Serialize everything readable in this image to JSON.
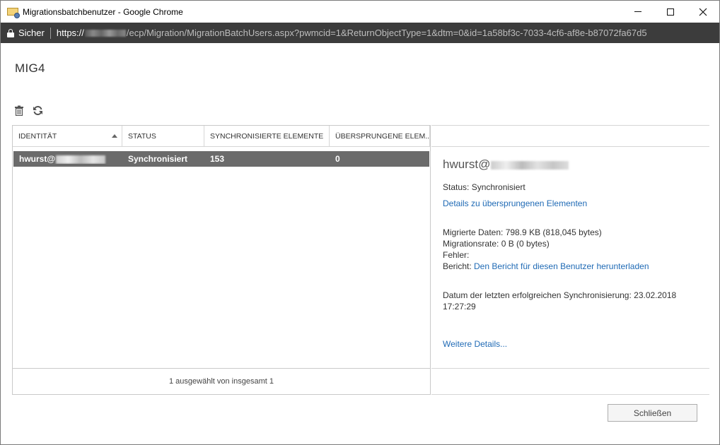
{
  "window": {
    "title": "Migrationsbatchbenutzer - Google Chrome",
    "buttons": {
      "minimize": "minimize",
      "maximize": "maximize",
      "close": "✕"
    }
  },
  "address": {
    "secure_label": "Sicher",
    "url_scheme": "https://",
    "url_rest": "/ecp/Migration/MigrationBatchUsers.aspx?pwmcid=1&ReturnObjectType=1&dtm=0&id=1a58bf3c-7033-4cf6-af8e-b87072fa67d5"
  },
  "page": {
    "title": "MIG4",
    "toolbar": {
      "delete_icon": "trash-icon",
      "refresh_icon": "refresh-icon"
    }
  },
  "table": {
    "columns": [
      "IDENTITÄT",
      "STATUS",
      "SYNCHRONISIERTE ELEMENTE",
      "ÜBERSPRUNGENE ELEM..."
    ],
    "rows": [
      {
        "identity_prefix": "hwurst@",
        "status": "Synchronisiert",
        "synced": "153",
        "skipped": "0"
      }
    ],
    "footer": "1 ausgewählt von insgesamt 1"
  },
  "details": {
    "name_prefix": "hwurst@",
    "status": "Status: Synchronisiert",
    "skipped_link": "Details zu übersprungenen Elementen",
    "migrated_data": "Migrierte Daten: 798.9 KB (818,045 bytes)",
    "migration_rate": "Migrationsrate: 0 B (0 bytes)",
    "errors": "Fehler:",
    "report_label": "Bericht: ",
    "report_link": "Den Bericht für diesen Benutzer herunterladen",
    "last_sync_line1": "Datum der letzten erfolgreichen Synchronisierung: 23.02.2018",
    "last_sync_line2": "17:27:29",
    "more_link": "Weitere Details..."
  },
  "footer": {
    "close_label": "Schließen"
  },
  "colors": {
    "address_bar": "#3c3c3c",
    "selected_row": "#6b6b6b",
    "link": "#1f6ab5"
  }
}
